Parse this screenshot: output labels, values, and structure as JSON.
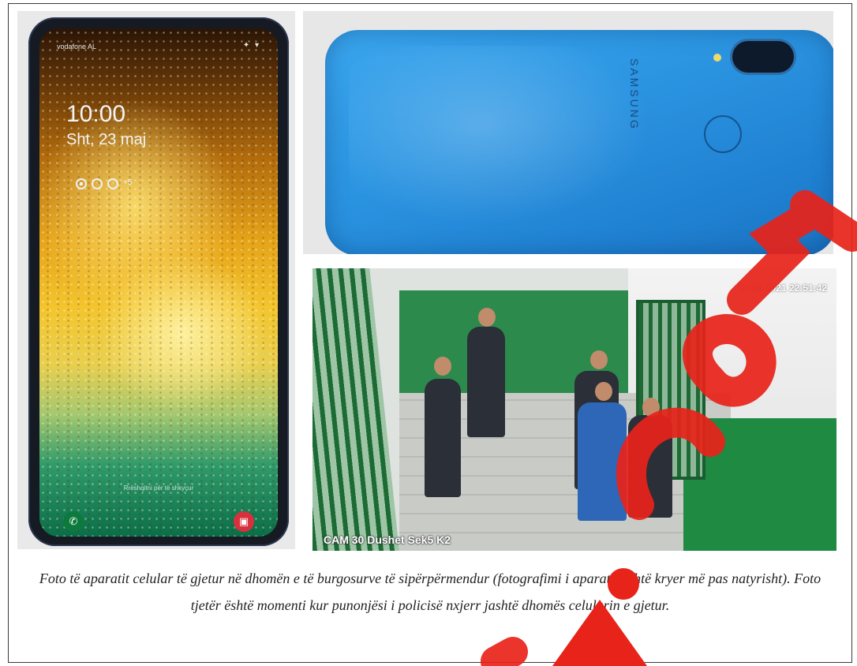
{
  "photos": {
    "phone_front": {
      "status_carrier": "vodafone AL",
      "status_right": "✦ ▾",
      "lock_time": "10:00",
      "lock_date": "Sht, 23 maj",
      "notification_icons": [
        "message-icon",
        "whatsapp-icon",
        "chat-icon",
        "more-icon"
      ],
      "notification_more": "+5",
      "swipe_hint": "Rrëshqitni për të shkyçur",
      "call_icon": "phone-call-icon",
      "camera_icon": "camera-icon"
    },
    "phone_back": {
      "brand": "SAMSUNG",
      "color": "#2b95e2"
    },
    "cctv": {
      "timestamp": "21-05-2021 22:51:42",
      "camera_label": "CAM 30 Dushet Sek5 K2"
    }
  },
  "caption": {
    "text": "Foto të aparatit celular të gjetur në dhomën e të burgosurve të sipërpërmendur (fotografimi i aparatit është kryer më pas natyrisht). Foto tjetër është momenti kur punonjësi i policisë nxjerr jashtë dhomës celularin e gjetur."
  },
  "watermark": {
    "color": "#e8231a"
  }
}
